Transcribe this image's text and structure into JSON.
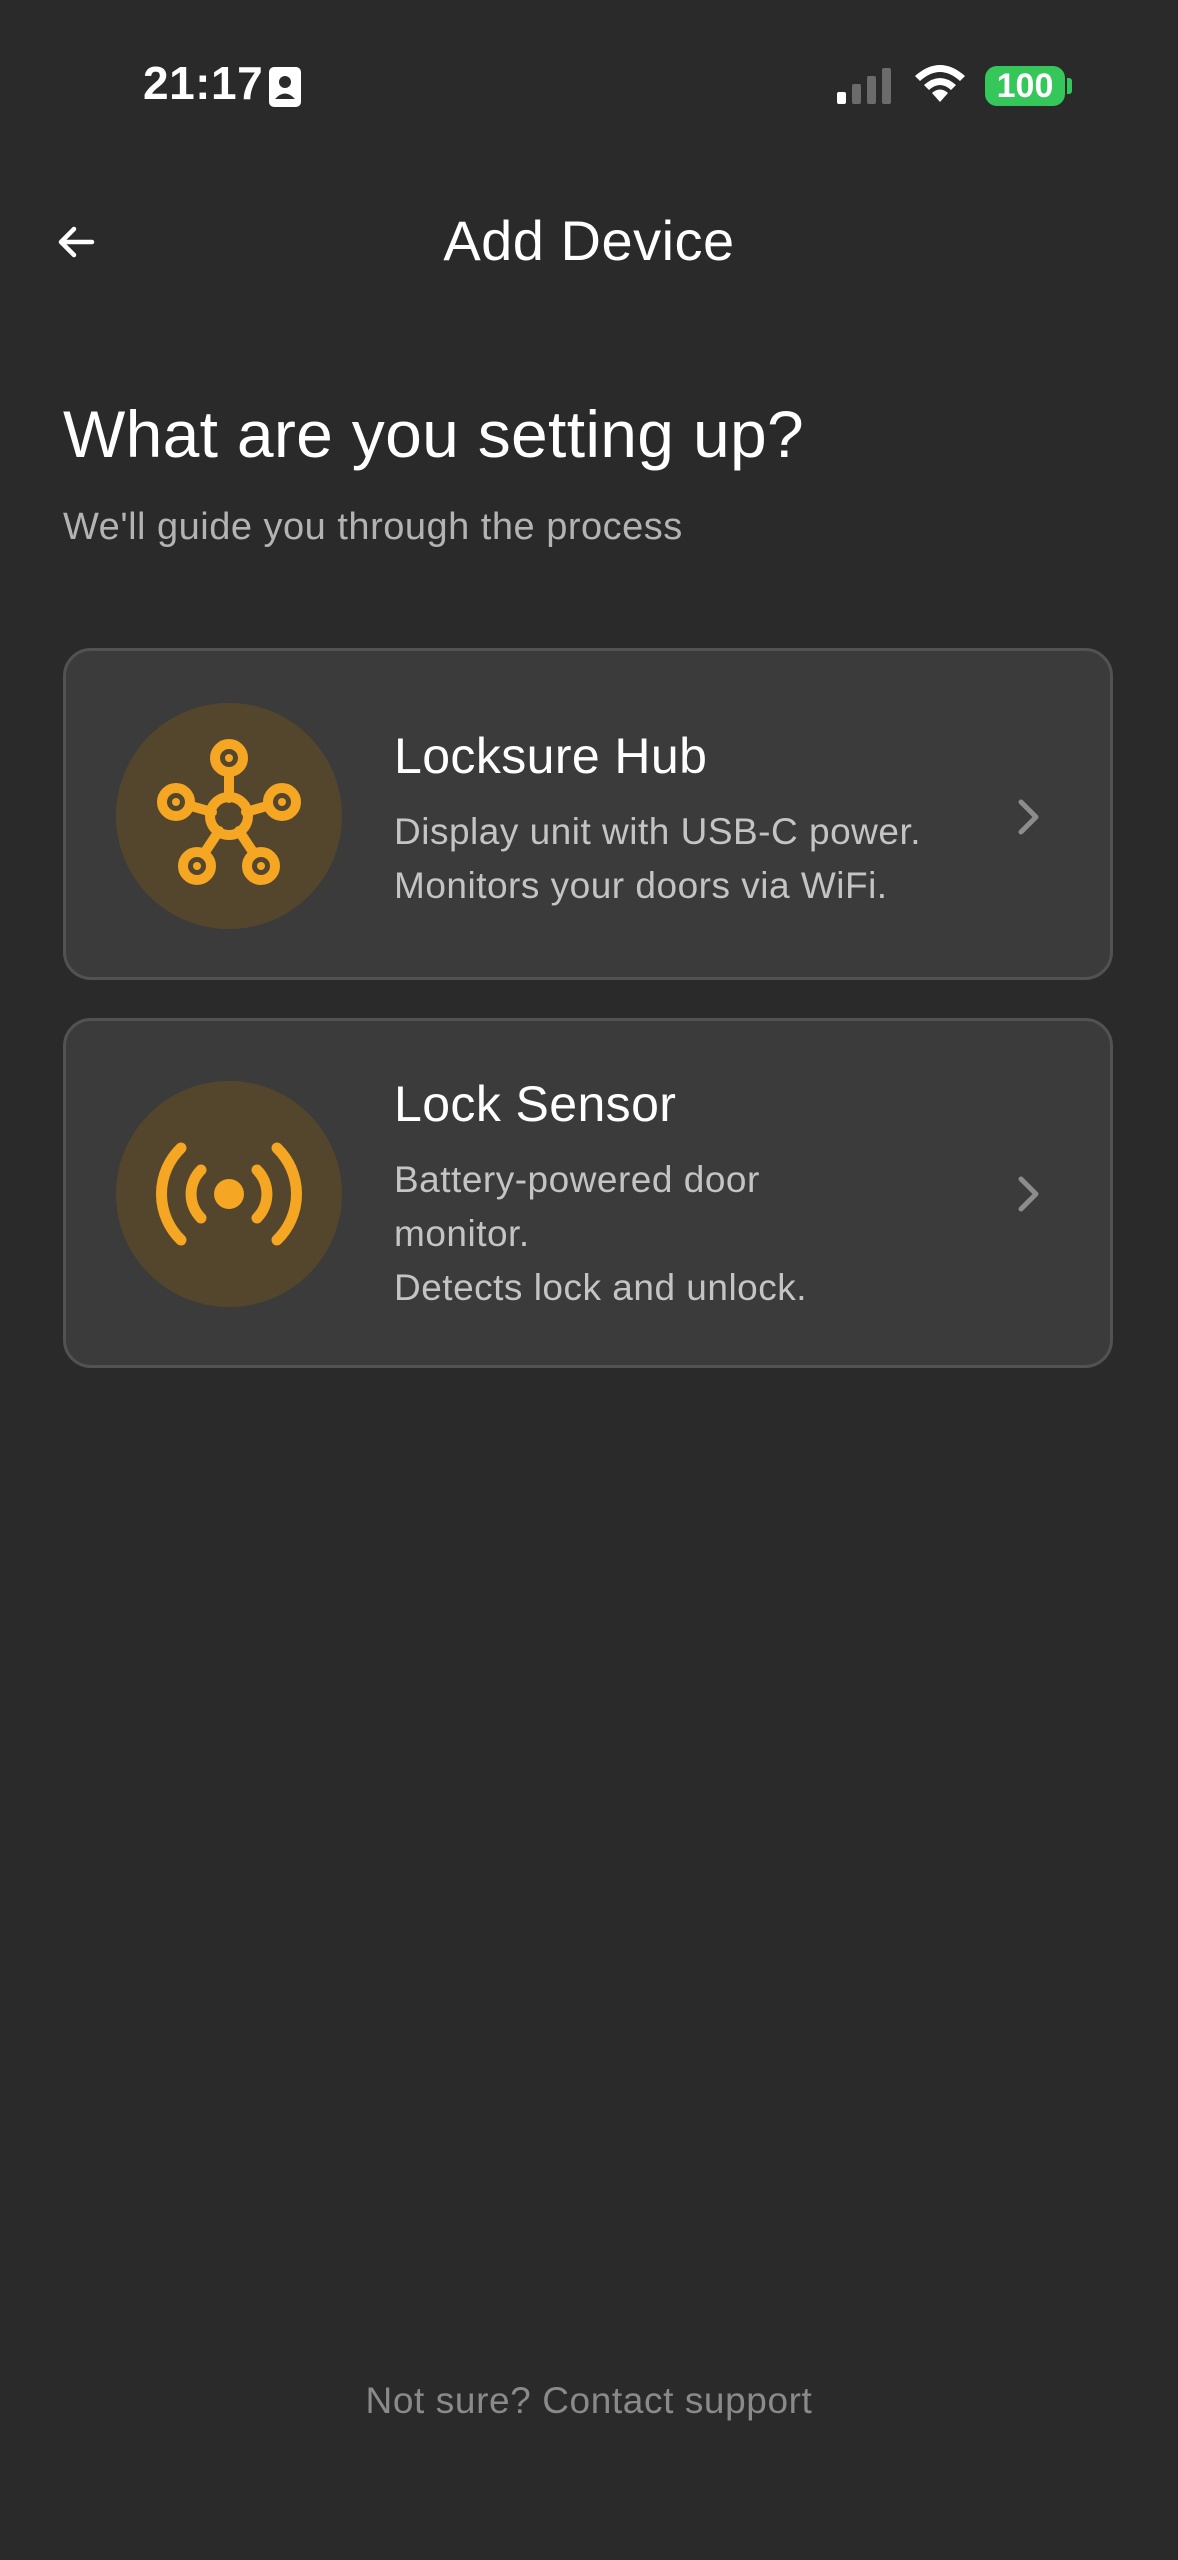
{
  "status_bar": {
    "time": "21:17",
    "battery": "100",
    "battery_color": "#35c759"
  },
  "header": {
    "title": "Add Device",
    "back_icon": "arrow-left-icon"
  },
  "intro": {
    "heading": "What are you setting up?",
    "subheading": "We'll guide you through the process"
  },
  "devices": [
    {
      "title": "Locksure Hub",
      "description_lines": [
        "Display unit with USB-C power.",
        "Monitors your doors via WiFi."
      ],
      "icon": "hub-network-icon"
    },
    {
      "title": "Lock Sensor",
      "description_lines": [
        "Battery-powered door",
        "monitor.",
        "Detects lock and unlock."
      ],
      "icon": "sensor-broadcast-icon"
    }
  ],
  "footer": {
    "support_link": "Not sure? Contact support"
  },
  "colors": {
    "background": "#2a2a2a",
    "card": "#3b3b3b",
    "accent": "#f5a623",
    "icon_circle": "#54462d"
  }
}
